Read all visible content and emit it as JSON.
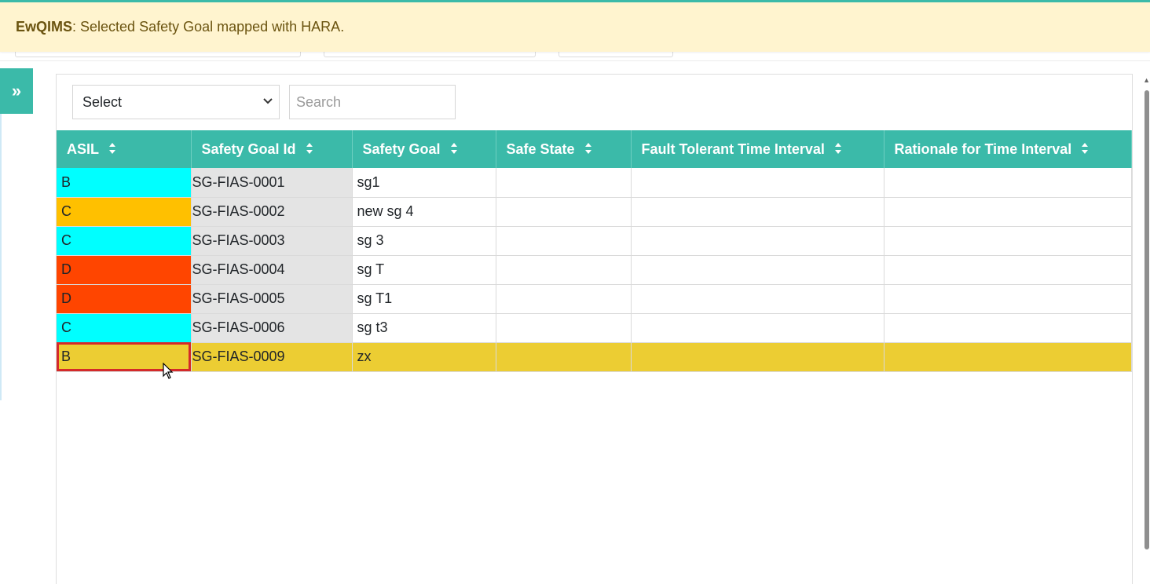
{
  "notification": {
    "app": "EwQIMS",
    "message": " : Selected Safety Goal mapped with HARA."
  },
  "toolbar": {
    "select_value": "Select",
    "search_placeholder": "Search"
  },
  "table": {
    "headers": [
      "ASIL",
      "Safety Goal Id",
      "Safety Goal",
      "Safe State",
      "Fault Tolerant Time Interval",
      "Rationale for Time Interval"
    ],
    "rows": [
      {
        "asil": "B",
        "asil_color": "#00ffff",
        "id": "SG-FIAS-0001",
        "goal": "sg1",
        "safe_state": "",
        "ftti": "",
        "rationale": ""
      },
      {
        "asil": "C",
        "asil_color": "#ffc000",
        "id": "SG-FIAS-0002",
        "goal": "new sg 4",
        "safe_state": "",
        "ftti": "",
        "rationale": ""
      },
      {
        "asil": "C",
        "asil_color": "#00ffff",
        "id": "SG-FIAS-0003",
        "goal": "sg 3",
        "safe_state": "",
        "ftti": "",
        "rationale": ""
      },
      {
        "asil": "D",
        "asil_color": "#ff4500",
        "id": "SG-FIAS-0004",
        "goal": "sg T",
        "safe_state": "",
        "ftti": "",
        "rationale": ""
      },
      {
        "asil": "D",
        "asil_color": "#ff4500",
        "id": "SG-FIAS-0005",
        "goal": "sg T1",
        "safe_state": "",
        "ftti": "",
        "rationale": ""
      },
      {
        "asil": "C",
        "asil_color": "#00ffff",
        "id": "SG-FIAS-0006",
        "goal": "sg t3",
        "safe_state": "",
        "ftti": "",
        "rationale": ""
      },
      {
        "asil": "B",
        "asil_color": "#eccd33",
        "id": "SG-FIAS-0009",
        "goal": "zx",
        "safe_state": "",
        "ftti": "",
        "rationale": "",
        "selected": true
      }
    ]
  },
  "icons": {
    "sidebar_toggle": "double-chevron-right-icon",
    "sort": "sort-icon",
    "select_arrow": "chevron-down-icon",
    "cursor": "mouse-pointer-icon"
  },
  "colors": {
    "accent": "#3bbaa9",
    "banner_bg": "#fff4cf",
    "banner_text": "#6b5410",
    "selected_row": "#eccd33",
    "selected_cell_border": "#d42a2a"
  }
}
